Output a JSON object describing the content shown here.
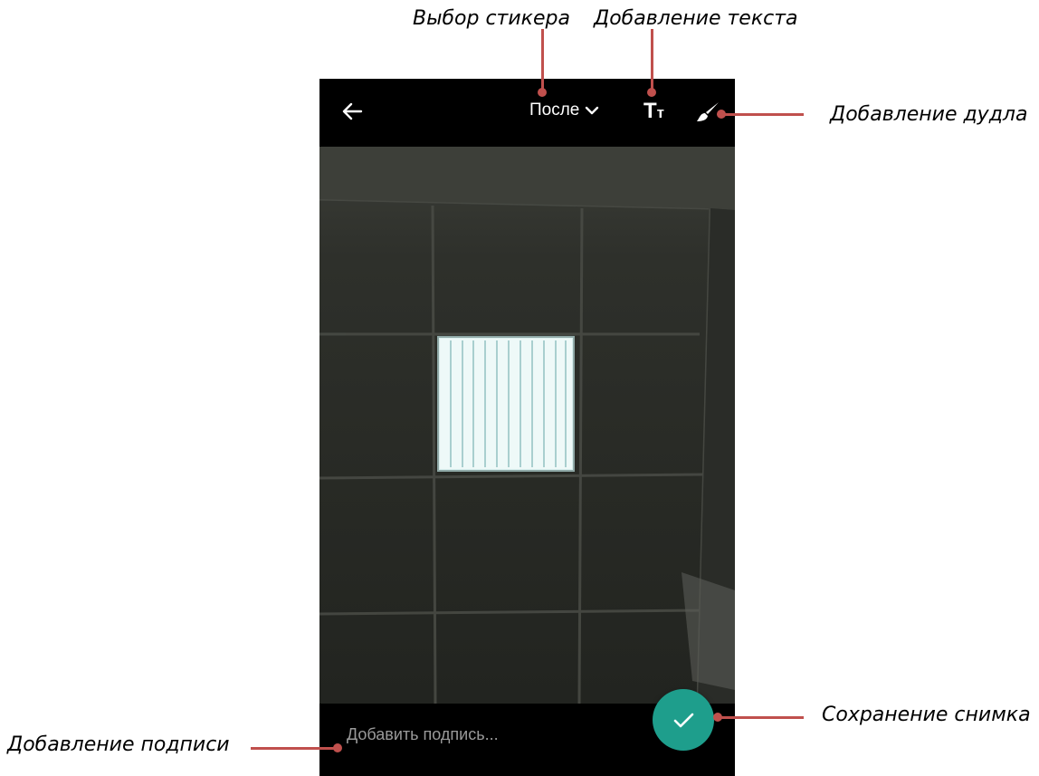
{
  "annotations": {
    "sticker": "Выбор стикера",
    "text": "Добавление текста",
    "doodle": "Добавление дудла",
    "save": "Сохранение снимка",
    "caption": "Добавление подписи"
  },
  "toolbar": {
    "sticker_label": "После",
    "text_icon_big": "T",
    "text_icon_small": "т",
    "icons": [
      "back-arrow-icon",
      "chevron-down-icon",
      "text-icon",
      "brush-icon"
    ]
  },
  "caption": {
    "placeholder": "Добавить подпись..."
  },
  "colors": {
    "annotation_line": "#c0504d",
    "fab": "#1e9e8c",
    "bar": "#000000"
  }
}
